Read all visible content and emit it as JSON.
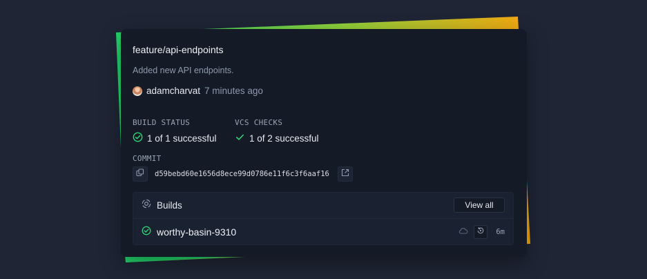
{
  "branch": "feature/api-endpoints",
  "commit_message": "Added new API endpoints.",
  "author": {
    "name": "adamcharvat",
    "time_ago": "7 minutes ago",
    "avatar_icon": "user-avatar"
  },
  "build_status": {
    "label": "BUILD STATUS",
    "value": "1 of 1 successful",
    "icon": "check-circle-icon"
  },
  "vcs_checks": {
    "label": "VCS CHECKS",
    "value": "1 of 2 successful",
    "icon": "check-icon"
  },
  "commit": {
    "label": "COMMIT",
    "sha": "d59bebd60e1656d8ece99d0786e11f6c3f6aaf16",
    "copy_icon": "copy-icon",
    "open_icon": "external-link-icon"
  },
  "builds": {
    "title": "Builds",
    "view_all_label": "View all",
    "items": [
      {
        "name": "worthy-basin-9310",
        "status": "success",
        "duration": "6m",
        "icons": [
          "cloud-icon",
          "rerun-icon"
        ]
      }
    ]
  },
  "colors": {
    "success": "#2fd47a",
    "accent_green": "#22d36a",
    "accent_orange": "#f5a70f",
    "background": "#1f2535",
    "card": "#141a26"
  }
}
